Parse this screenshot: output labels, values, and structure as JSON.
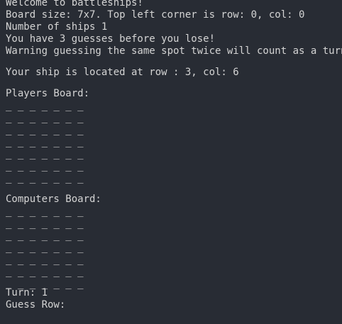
{
  "intro": {
    "welcome": "Welcome to battleships!",
    "board_size": "Board size: 7x7. Top left corner is row: 0, col: 0",
    "num_ships": "Number of ships 1",
    "guesses": "You have 3 guesses before you lose!",
    "warning": "Warning guessing the same spot twice will count as a turn!"
  },
  "ship_location": "Your ship is located at row : 3, col: 6",
  "players_board": {
    "title": "Players Board:",
    "rows": [
      "_ _ _ _ _ _ _",
      "_ _ _ _ _ _ _",
      "_ _ _ _ _ _ _",
      "_ _ _ _ _ _ _",
      "_ _ _ _ _ _ _",
      "_ _ _ _ _ _ _",
      "_ _ _ _ _ _ _"
    ]
  },
  "computers_board": {
    "title": "Computers Board:",
    "rows": [
      "_ _ _ _ _ _ _",
      "_ _ _ _ _ _ _",
      "_ _ _ _ _ _ _",
      "_ _ _ _ _ _ _",
      "_ _ _ _ _ _ _",
      "_ _ _ _ _ _ _",
      "_ _ _ _ _ _ _"
    ]
  },
  "turn": "Turn: 1",
  "guess_prompt": "Guess Row:"
}
